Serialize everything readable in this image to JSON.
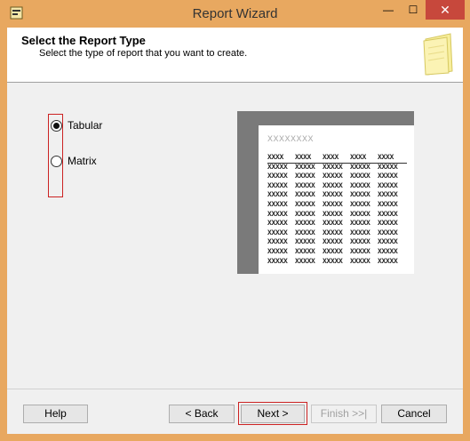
{
  "window": {
    "title": "Report Wizard",
    "minimize_glyph": "—",
    "maximize_glyph": "☐",
    "close_glyph": "✕"
  },
  "header": {
    "title": "Select the Report Type",
    "subtitle": "Select the type of report that you want to create."
  },
  "report_types": [
    {
      "label": "Tabular",
      "selected": true
    },
    {
      "label": "Matrix",
      "selected": false
    }
  ],
  "preview": {
    "title": "XXXXXXXX",
    "header_cells": [
      "XXXX",
      "XXXX",
      "XXXX",
      "XXXX",
      "XXXX"
    ],
    "cell_text": "XXXXX",
    "rows": 11
  },
  "buttons": {
    "help": "Help",
    "back": "< Back",
    "next": "Next >",
    "finish": "Finish >>|",
    "cancel": "Cancel"
  }
}
